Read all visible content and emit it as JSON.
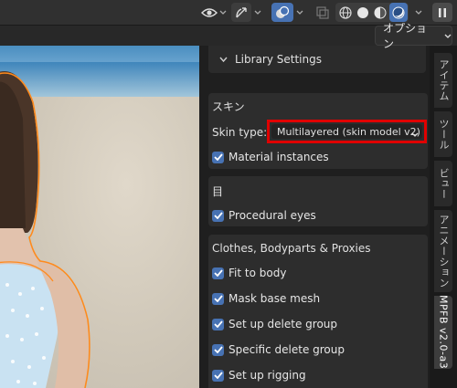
{
  "header": {
    "icons": [
      "eye-icon",
      "gizmo-icon",
      "overlay-icon",
      "xray-icon",
      "wireframe-icon",
      "solid-icon",
      "material-preview-icon",
      "rendered-icon",
      "pause-icon"
    ]
  },
  "subheader": {
    "options_label": "オプション"
  },
  "panel": {
    "library_settings": "Library Settings",
    "skin": {
      "title": "スキン",
      "skin_type_label": "Skin type:",
      "skin_type_value": "Multilayered (skin model v2)",
      "material_instances": "Material instances"
    },
    "eyes": {
      "title": "目",
      "procedural_eyes": "Procedural eyes"
    },
    "clothes": {
      "title": "Clothes, Bodyparts & Proxies",
      "items": [
        "Fit to body",
        "Mask base mesh",
        "Set up delete group",
        "Specific delete group",
        "Set up rigging"
      ]
    }
  },
  "tabs": [
    "アイテム",
    "ツール",
    "ビュー",
    "アニメーション",
    "MPFB v2.0-a3"
  ],
  "colors": {
    "checkbox": "#4772b3",
    "highlight": "#e00000",
    "active_blue": "#4772b3",
    "selection_orange": "#ff8a1c"
  }
}
